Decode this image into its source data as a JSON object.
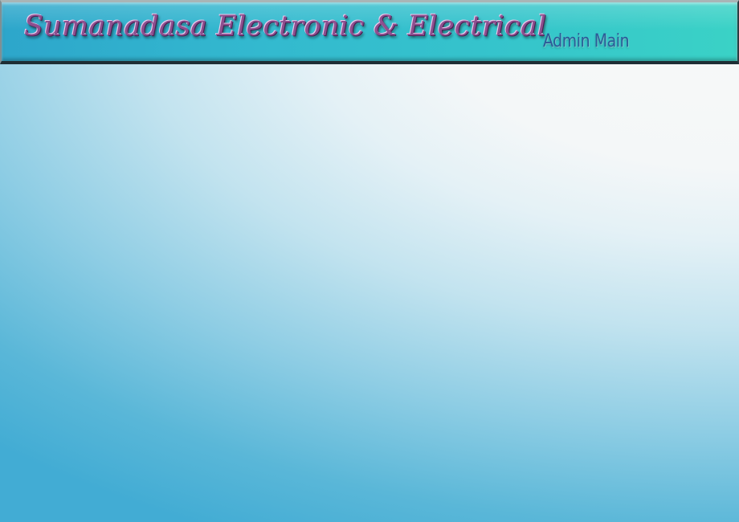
{
  "header": {
    "app_title": "Sumanadasa Electronic & Electrical",
    "page_label": "Admin Main"
  },
  "colors": {
    "header_gradient_start": "#2da6cb",
    "header_gradient_end": "#3ad2c6",
    "title_text": "#8e4f8f",
    "page_label_text": "#2b5b98",
    "background_light": "#f8f9f9",
    "background_blue": "#42acd4"
  }
}
